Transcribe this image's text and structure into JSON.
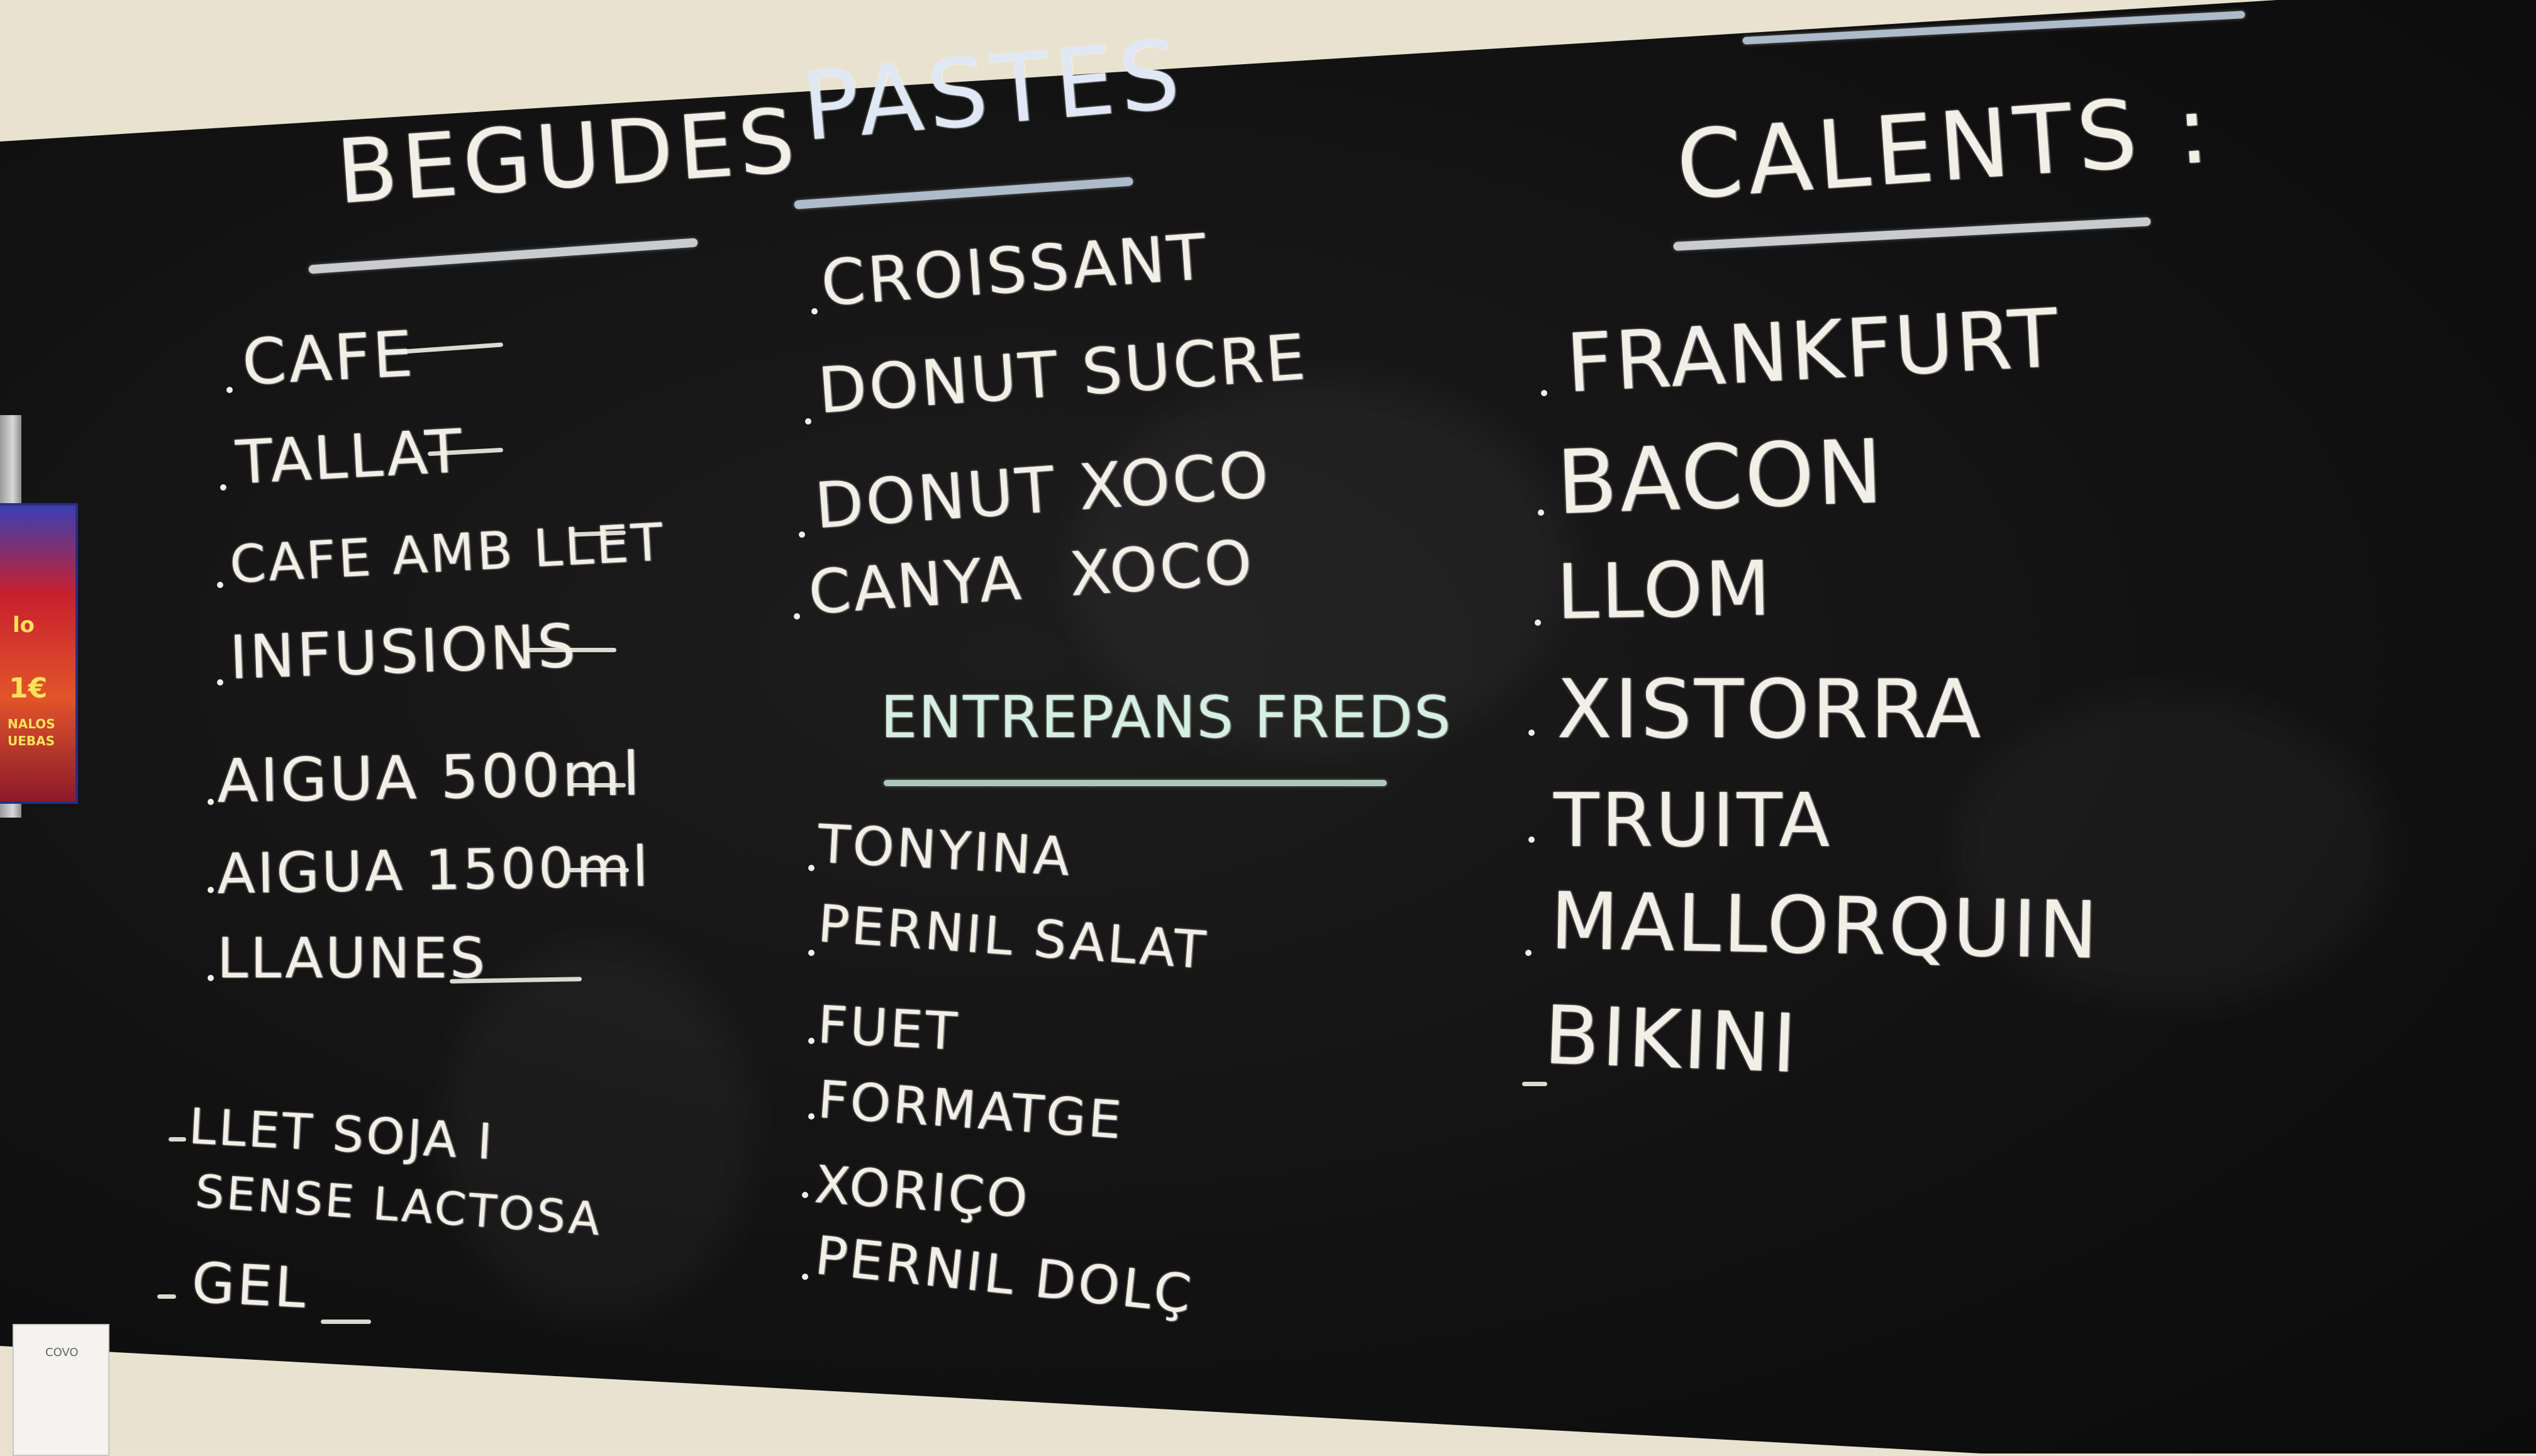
{
  "image_description_free": true,
  "menu": {
    "begudes": {
      "title": "BEGUDES",
      "items": [
        "CAFE",
        "TALLAT",
        "CAFE AMB LLET",
        "INFUSIONS",
        "AIGUA 500ml",
        "AIGUA 1500ml",
        "LLAUNES"
      ],
      "extras": [
        "LLET SOJA I",
        "SENSE LACTOSA",
        "GEL"
      ]
    },
    "pastes": {
      "title": "PASTES",
      "items": [
        "CROISSANT",
        "DONUT SUCRE",
        "DONUT XOCO",
        "CANYA XOCO"
      ]
    },
    "entrepans_freds": {
      "title": "ENTREPANS FREDS",
      "items": [
        "TONYINA",
        "PERNIL SALAT",
        "FUET",
        "FORMATGE",
        "XORIÇO",
        "PERNIL DOLÇ"
      ]
    },
    "calents": {
      "title": "CALENTS :",
      "items": [
        "FRANKFURT",
        "BACON",
        "LLOM",
        "XISTORRA",
        "TRUITA",
        "MALLORQUIN",
        "BIKINI"
      ]
    }
  },
  "poster": {
    "line1": "lo",
    "line2": "1€",
    "line3": "NALOS",
    "line4": "UEBAS"
  },
  "card": {
    "label": "COVO"
  },
  "colors": {
    "chalk": "#f1efe6",
    "board": "#141414",
    "wall": "#e8e2cf",
    "accent_blue": "#c9d8ea",
    "accent_mint": "#c8e6d8"
  }
}
